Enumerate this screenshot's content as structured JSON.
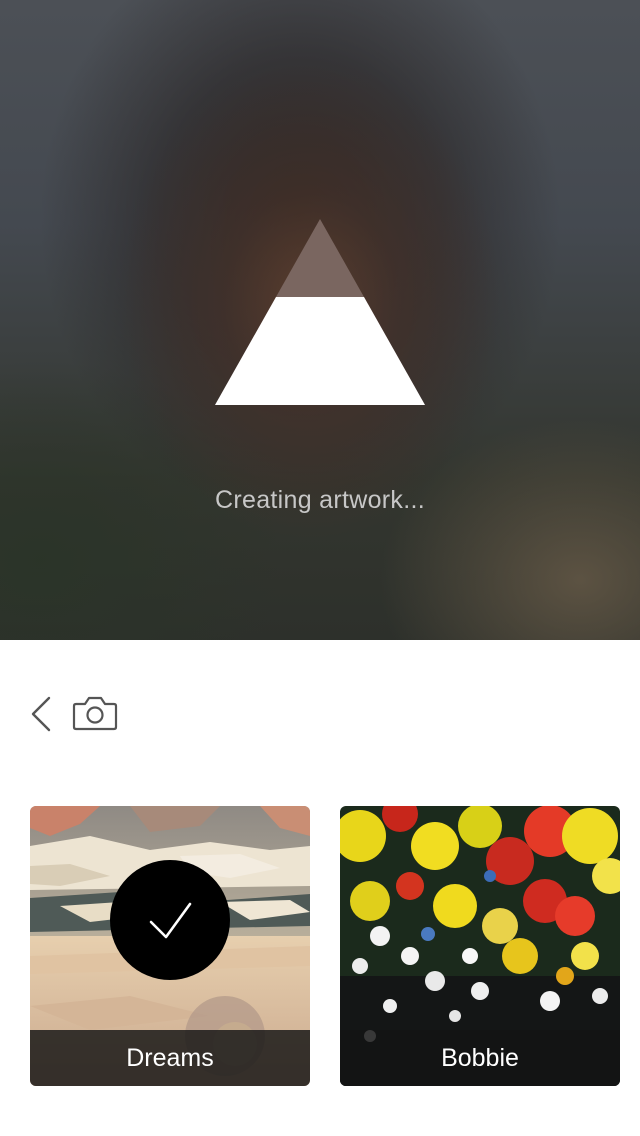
{
  "preview": {
    "status_text": "Creating artwork...",
    "loader_icon": "mountain-triangle-icon",
    "loader_progress": 0.42
  },
  "toolbar": {
    "back_icon": "chevron-left-icon",
    "camera_icon": "camera-icon"
  },
  "styles": [
    {
      "label": "Dreams",
      "selected": true,
      "badge_icon": "checkmark-icon"
    },
    {
      "label": "Bobbie",
      "selected": false
    }
  ],
  "colors": {
    "selected_badge": "#000000",
    "label_bar": "#141414",
    "status_text": "#c7c7c7"
  }
}
